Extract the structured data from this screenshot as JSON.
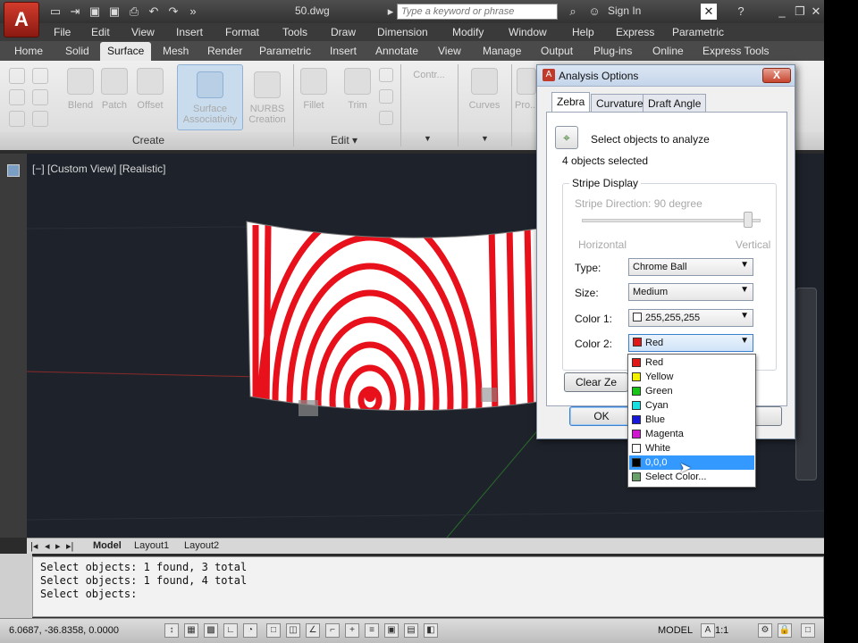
{
  "titlebar": {
    "app_button_glyph": "A",
    "file_title": "50.dwg",
    "search_placeholder": "Type a keyword or phrase",
    "sign_in": "Sign In"
  },
  "menubar": {
    "items": [
      "File",
      "Edit",
      "View",
      "Insert",
      "Format",
      "Tools",
      "Draw",
      "Dimension",
      "Modify",
      "Window",
      "Help",
      "Express",
      "Parametric"
    ]
  },
  "ribbon_tabs": {
    "items": [
      "Home",
      "Solid",
      "Surface",
      "Mesh",
      "Render",
      "Parametric",
      "Insert",
      "Annotate",
      "View",
      "Manage",
      "Output",
      "Plug-ins",
      "Online",
      "Express Tools"
    ],
    "active": "Surface"
  },
  "ribbon": {
    "buttons": {
      "blend": "Blend",
      "patch": "Patch",
      "offset": "Offset",
      "surface_assoc_1": "Surface",
      "surface_assoc_2": "Associativity",
      "nurbs_1": "NURBS",
      "nurbs_2": "Creation",
      "fillet": "Fillet",
      "trim": "Trim",
      "control": "Contr...",
      "curves": "Curves",
      "project": "Pro..."
    },
    "panels": {
      "create": "Create",
      "edit": "Edit ▾"
    }
  },
  "viewport": {
    "label": "[−] [Custom View] [Realistic]"
  },
  "layout_tabs": [
    "Model",
    "Layout1",
    "Layout2"
  ],
  "command_line": [
    "Select objects: 1 found, 3 total",
    "Select objects: 1 found, 4 total",
    "Select objects:"
  ],
  "statusbar": {
    "coords": "6.0687, -36.8358, 0.0000",
    "model": "MODEL",
    "scale": "1:1"
  },
  "dialog": {
    "title": "Analysis Options",
    "close": "X",
    "tabs": [
      "Zebra",
      "Curvature",
      "Draft Angle"
    ],
    "active_tab": "Zebra",
    "select_prompt": "Select objects to analyze",
    "selected_count": "4 objects selected",
    "stripe_group": "Stripe Display",
    "stripe_direction": "Stripe Direction: 90 degree",
    "horizontal": "Horizontal",
    "vertical": "Vertical",
    "type_label": "Type:",
    "type_value": "Chrome Ball",
    "size_label": "Size:",
    "size_value": "Medium",
    "color1_label": "Color 1:",
    "color1_value": "255,255,255",
    "color2_label": "Color 2:",
    "color2_value": "Red",
    "clear_button": "Clear Ze",
    "ok_button": "OK",
    "slider_position": 0.95
  },
  "color_dropdown": {
    "options": [
      {
        "label": "Red",
        "color": "#e01818"
      },
      {
        "label": "Yellow",
        "color": "#f2f200"
      },
      {
        "label": "Green",
        "color": "#18c418"
      },
      {
        "label": "Cyan",
        "color": "#18e0e0"
      },
      {
        "label": "Blue",
        "color": "#1818d8"
      },
      {
        "label": "Magenta",
        "color": "#d018d0"
      },
      {
        "label": "White",
        "color": "#ffffff"
      },
      {
        "label": "0,0,0",
        "color": "#000000"
      },
      {
        "label": "Select Color...",
        "color": "#6aa06a"
      }
    ],
    "highlighted": "0,0,0"
  },
  "colors": {
    "zebra_red": "#e8101a",
    "zebra_white": "#ffffff",
    "viewport_bg": "#1e232b",
    "accent": "#3399ff"
  }
}
